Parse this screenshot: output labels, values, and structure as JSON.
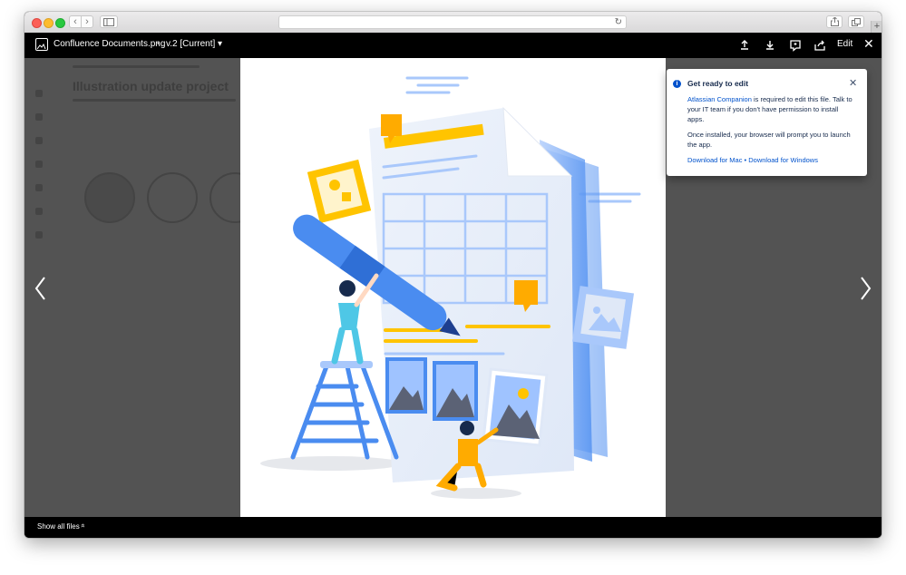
{
  "browser": {
    "back_icon": "‹",
    "forward_icon": "›",
    "reload_icon": "↻",
    "new_tab_icon": "+"
  },
  "viewer": {
    "file_name": "Confluence Documents.png",
    "separator": "•",
    "version": "v.2 [Current] ▾",
    "edit_label": "Edit",
    "close_icon": "✕"
  },
  "background_page": {
    "title": "Illustration update project"
  },
  "popup": {
    "info_icon": "i",
    "title": "Get ready to edit",
    "close_icon": "✕",
    "companion_link": "Atlassian Companion",
    "body_text_1": " is required to edit this file. Talk to your IT team if you don't have permission to install apps.",
    "body_text_2": "Once installed, your browser will prompt you to launch the app.",
    "download_mac": "Download for Mac",
    "link_separator": " • ",
    "download_windows": "Download for Windows"
  },
  "footer": {
    "show_all_files": "Show all files",
    "chevron": "»"
  },
  "colors": {
    "accent_blue": "#0052cc",
    "illustration_blue": "#4a8cf0",
    "illustration_yellow": "#ffc400",
    "illustration_orange": "#ffab00"
  }
}
